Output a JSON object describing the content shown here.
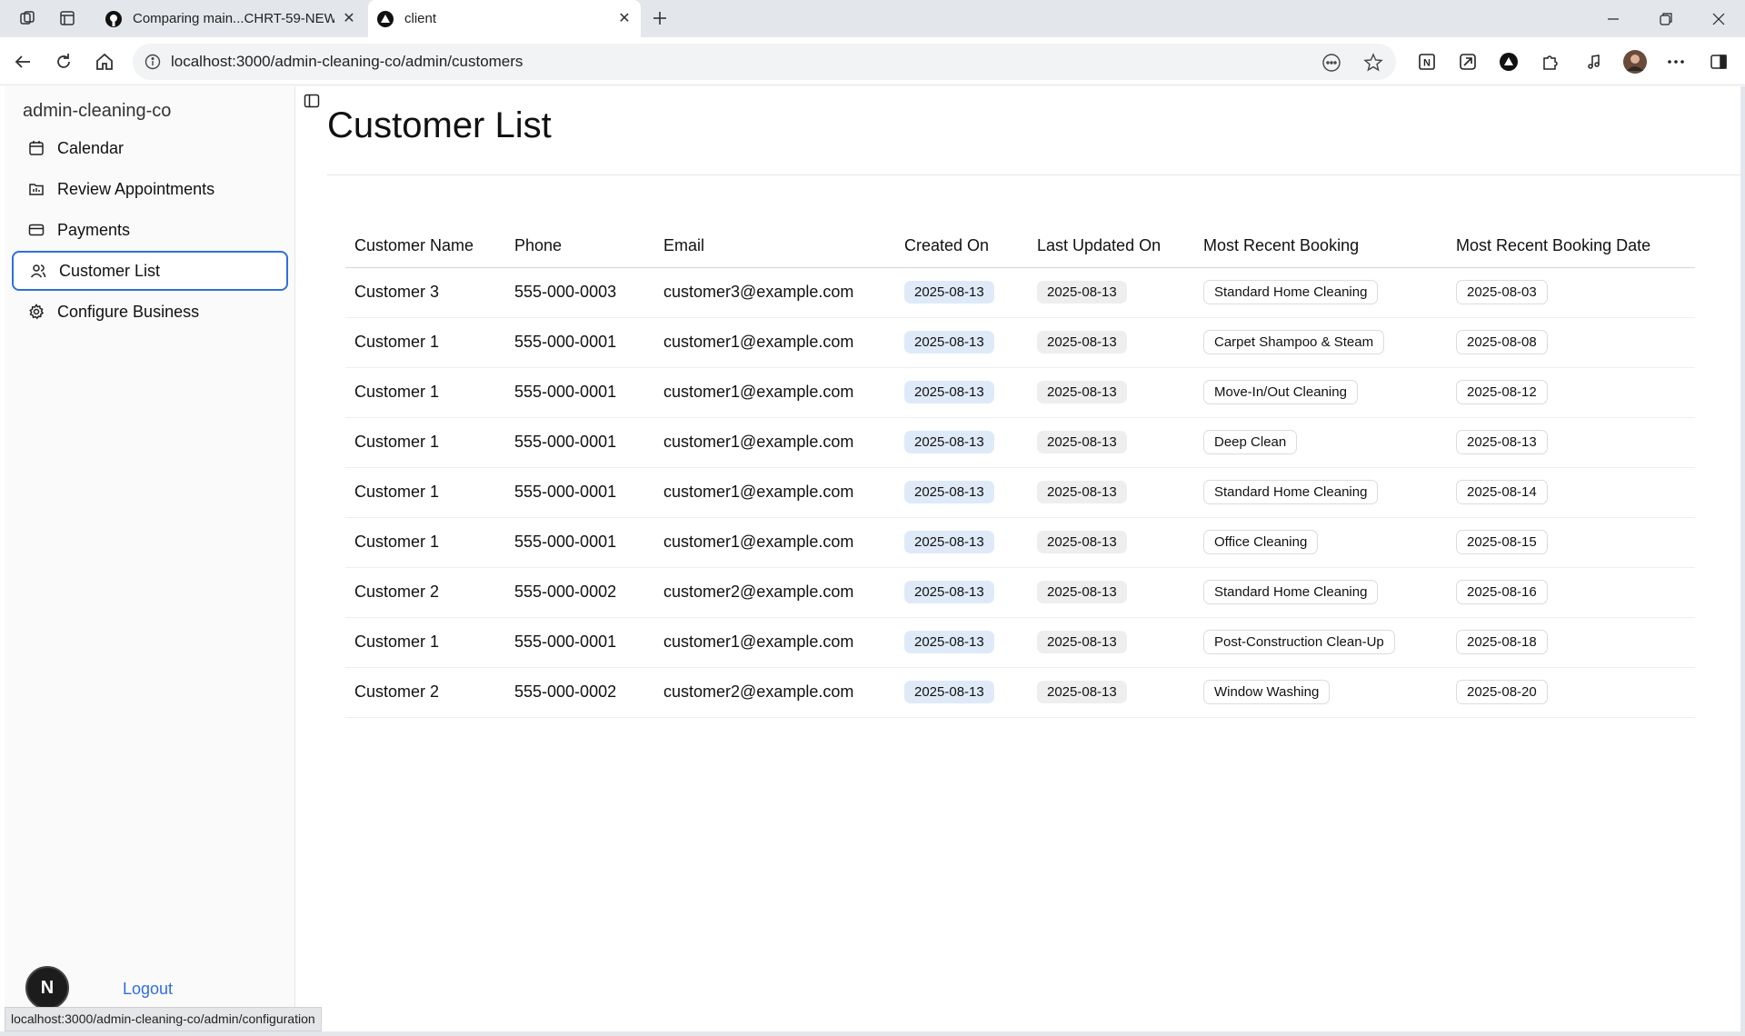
{
  "browser": {
    "tabs": [
      {
        "label": "Comparing main...CHRT-59-NEW",
        "active": false
      },
      {
        "label": "client",
        "active": true
      }
    ],
    "url": "localhost:3000/admin-cleaning-co/admin/customers",
    "status_url": "localhost:3000/admin-cleaning-co/admin/configuration",
    "icons": {
      "back": "arrow-left-icon",
      "reload": "reload-icon",
      "home": "home-icon",
      "new_tab": "plus-icon"
    }
  },
  "sidebar": {
    "brand": "admin-cleaning-co",
    "items": [
      {
        "label": "Calendar",
        "icon": "calendar-icon",
        "active": false
      },
      {
        "label": "Review Appointments",
        "icon": "review-icon",
        "active": false
      },
      {
        "label": "Payments",
        "icon": "card-icon",
        "active": false
      },
      {
        "label": "Customer List",
        "icon": "users-icon",
        "active": true
      },
      {
        "label": "Configure Business",
        "icon": "gear-icon",
        "active": false
      }
    ],
    "avatar_letter": "N",
    "logout_label": "Logout"
  },
  "main": {
    "title": "Customer List",
    "columns": [
      "Customer Name",
      "Phone",
      "Email",
      "Created On",
      "Last Updated On",
      "Most Recent Booking",
      "Most Recent Booking Date"
    ],
    "rows": [
      {
        "name": "Customer 3",
        "phone": "555-000-0003",
        "email": "customer3@example.com",
        "created": "2025-08-13",
        "updated": "2025-08-13",
        "booking": "Standard Home Cleaning",
        "booking_date": "2025-08-03"
      },
      {
        "name": "Customer 1",
        "phone": "555-000-0001",
        "email": "customer1@example.com",
        "created": "2025-08-13",
        "updated": "2025-08-13",
        "booking": "Carpet Shampoo & Steam",
        "booking_date": "2025-08-08"
      },
      {
        "name": "Customer 1",
        "phone": "555-000-0001",
        "email": "customer1@example.com",
        "created": "2025-08-13",
        "updated": "2025-08-13",
        "booking": "Move-In/Out Cleaning",
        "booking_date": "2025-08-12"
      },
      {
        "name": "Customer 1",
        "phone": "555-000-0001",
        "email": "customer1@example.com",
        "created": "2025-08-13",
        "updated": "2025-08-13",
        "booking": "Deep Clean",
        "booking_date": "2025-08-13"
      },
      {
        "name": "Customer 1",
        "phone": "555-000-0001",
        "email": "customer1@example.com",
        "created": "2025-08-13",
        "updated": "2025-08-13",
        "booking": "Standard Home Cleaning",
        "booking_date": "2025-08-14"
      },
      {
        "name": "Customer 1",
        "phone": "555-000-0001",
        "email": "customer1@example.com",
        "created": "2025-08-13",
        "updated": "2025-08-13",
        "booking": "Office Cleaning",
        "booking_date": "2025-08-15"
      },
      {
        "name": "Customer 2",
        "phone": "555-000-0002",
        "email": "customer2@example.com",
        "created": "2025-08-13",
        "updated": "2025-08-13",
        "booking": "Standard Home Cleaning",
        "booking_date": "2025-08-16"
      },
      {
        "name": "Customer 1",
        "phone": "555-000-0001",
        "email": "customer1@example.com",
        "created": "2025-08-13",
        "updated": "2025-08-13",
        "booking": "Post-Construction Clean-Up",
        "booking_date": "2025-08-18"
      },
      {
        "name": "Customer 2",
        "phone": "555-000-0002",
        "email": "customer2@example.com",
        "created": "2025-08-13",
        "updated": "2025-08-13",
        "booking": "Window Washing",
        "booking_date": "2025-08-20"
      }
    ]
  },
  "colors": {
    "accent": "#2f6fdf",
    "created_pill": "#dfeaf8",
    "updated_pill": "#eeeeee"
  }
}
